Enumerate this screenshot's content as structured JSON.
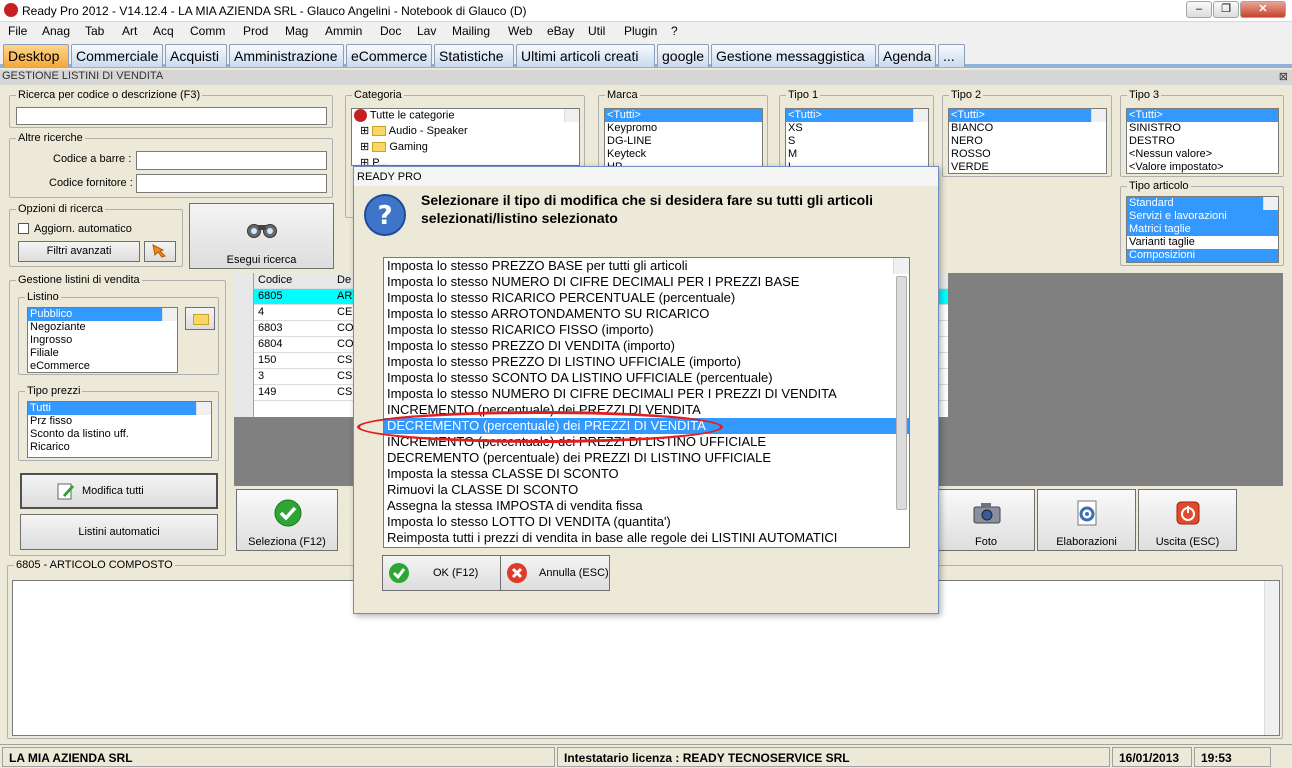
{
  "window": {
    "title": "Ready Pro 2012 - V14.12.4 - LA MIA AZIENDA SRL - Glauco Angelini - Notebook di Glauco (D)",
    "minimize": "–",
    "restore": "❐",
    "close": "✕"
  },
  "menu": [
    "File",
    "Anag",
    "Tab",
    "Art",
    "Acq",
    "Comm",
    "Prod",
    "Mag",
    "Ammin",
    "Doc",
    "Lav",
    "Mailing",
    "Web",
    "eBay",
    "Util",
    "Plugin",
    "?"
  ],
  "tabs": [
    "Desktop",
    "Commerciale",
    "Acquisti",
    "Amministrazione",
    "eCommerce",
    "Statistiche",
    "Ultimi articoli creati",
    "google",
    "Gestione messaggistica",
    "Agenda",
    "..."
  ],
  "panel_title": "GESTIONE LISTINI DI VENDITA",
  "panel_close": "⊠",
  "search": {
    "label": "Ricerca per codice o descrizione (F3)",
    "value": ""
  },
  "other_search": {
    "label": "Altre ricerche",
    "barcode_label": "Codice a barre :",
    "supplier_label": "Codice fornitore :"
  },
  "options": {
    "label": "Opzioni di ricerca",
    "auto_update": "Aggiorn. automatico",
    "advanced_filters": "Filtri avanzati"
  },
  "search_button": "Esegui ricerca",
  "category": {
    "label": "Categoria",
    "items": [
      "Tutte le categorie",
      "Audio - Speaker",
      "Gaming",
      "P..."
    ]
  },
  "brand": {
    "label": "Marca",
    "items": [
      "<Tutti>",
      "Keypromo",
      "DG-LINE",
      "Keyteck",
      "HP"
    ]
  },
  "tipo1": {
    "label": "Tipo 1",
    "items": [
      "<Tutti>",
      "XS",
      "S",
      "M",
      "L"
    ]
  },
  "tipo2": {
    "label": "Tipo 2",
    "items": [
      "<Tutti>",
      "BIANCO",
      "NERO",
      "ROSSO",
      "VERDE"
    ]
  },
  "tipo3": {
    "label": "Tipo 3",
    "items": [
      "<Tutti>",
      "SINISTRO",
      "DESTRO",
      "<Nessun valore>",
      "<Valore impostato>"
    ]
  },
  "article_type": {
    "label": "Tipo articolo",
    "items": [
      "Standard",
      "Servizi e lavorazioni",
      "Matrici taglie",
      "Varianti taglie",
      "Composizioni"
    ]
  },
  "price_lists": {
    "label": "Gestione listini di vendita",
    "listino_label": "Listino",
    "items": [
      "Pubblico",
      "Negoziante",
      "Ingrosso",
      "Filiale",
      "eCommerce"
    ]
  },
  "price_types": {
    "label": "Tipo prezzi",
    "items": [
      "Tutti",
      "Prz fisso",
      "Sconto da listino uff.",
      "Ricarico"
    ]
  },
  "modify_all": "Modifica tutti",
  "auto_lists": "Listini automatici",
  "table": {
    "headers": [
      "Codice",
      "De"
    ],
    "rows": [
      [
        "6805",
        "AR"
      ],
      [
        "4",
        "CE"
      ],
      [
        "6803",
        "CO"
      ],
      [
        "6804",
        "CO"
      ],
      [
        "150",
        "CS"
      ],
      [
        "3",
        "CS"
      ],
      [
        "149",
        "CS"
      ]
    ]
  },
  "bottom_buttons": {
    "select": "Seleziona (F12)",
    "photo": "Foto",
    "elaborations": "Elaborazioni",
    "exit": "Uscita (ESC)"
  },
  "article_panel": {
    "label": "6805 - ARTICOLO COMPOSTO"
  },
  "status": {
    "company": "LA MIA AZIENDA SRL",
    "license": "Intestatario licenza : READY TECNOSERVICE SRL",
    "date": "16/01/2013",
    "time": "19:53"
  },
  "dialog": {
    "title": "READY PRO",
    "message": "Selezionare il tipo di modifica che si desidera fare su tutti gli articoli selezionati/listino selezionato",
    "options": [
      "Imposta lo stesso PREZZO BASE per tutti gli articoli",
      "Imposta lo stesso NUMERO DI CIFRE DECIMALI PER I PREZZI BASE",
      "Imposta lo stesso RICARICO PERCENTUALE (percentuale)",
      "Imposta lo stesso ARROTONDAMENTO SU RICARICO",
      "Imposta lo stesso RICARICO FISSO (importo)",
      "Imposta lo stesso PREZZO DI VENDITA (importo)",
      "Imposta lo stesso PREZZO DI LISTINO UFFICIALE (importo)",
      "Imposta lo stesso SCONTO DA LISTINO UFFICIALE (percentuale)",
      "Imposta lo stesso NUMERO DI CIFRE DECIMALI PER I PREZZI DI VENDITA",
      "INCREMENTO (percentuale) dei PREZZI DI VENDITA",
      "DECREMENTO (percentuale) dei PREZZI DI VENDITA",
      "INCREMENTO (percentuale) dei PREZZI DI LISTINO UFFICIALE",
      "DECREMENTO (percentuale) dei PREZZI DI LISTINO UFFICIALE",
      "Imposta la stessa CLASSE DI SCONTO",
      "Rimuovi la CLASSE DI SCONTO",
      "Assegna la stessa IMPOSTA di vendita fissa",
      "Imposta lo stesso LOTTO DI VENDITA (quantita')",
      "Reimposta tutti i prezzi di vendita in base alle regole dei LISTINI AUTOMATICI"
    ],
    "selected_index": 10,
    "ok": "OK (F12)",
    "cancel": "Annulla (ESC)"
  }
}
